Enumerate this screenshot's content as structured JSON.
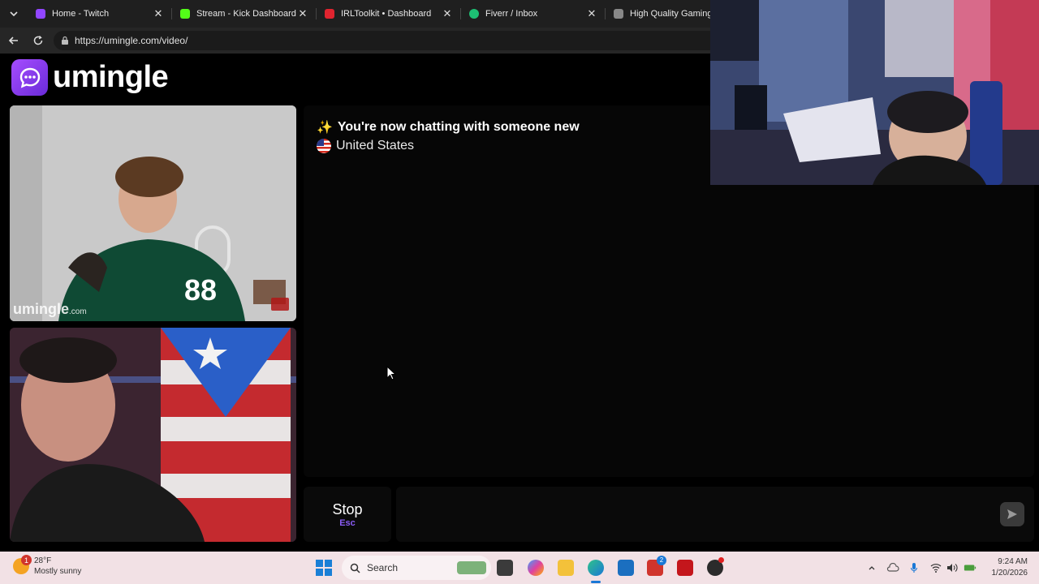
{
  "browser": {
    "tabs": [
      {
        "title": "Home - Twitch",
        "favicon_color": "#9146ff"
      },
      {
        "title": "Stream - Kick Dashboard",
        "favicon_color": "#53fc18"
      },
      {
        "title": "IRLToolkit • Dashboard",
        "favicon_color": "#e0242f"
      },
      {
        "title": "Fiverr / Inbox",
        "favicon_color": "#1dbf73"
      },
      {
        "title": "High Quality Gaming Ge",
        "favicon_color": "#888888"
      }
    ],
    "url": "https://umingle.com/video/"
  },
  "site": {
    "logo_text": "umingle",
    "brand_color": "#8b3dff"
  },
  "videos": {
    "stranger_watermark": "umingle",
    "stranger_watermark_suffix": ".com"
  },
  "chat": {
    "status_message": "You're now chatting with someone new",
    "country": "United States"
  },
  "controls": {
    "stop_label": "Stop",
    "stop_shortcut": "Esc",
    "message_value": ""
  },
  "taskbar": {
    "weather_temp": "28°F",
    "weather_desc": "Mostly sunny",
    "weather_badge": "1",
    "search_label": "Search",
    "notification_count": "2",
    "time": "9:24 AM",
    "date": "1/20/2026"
  }
}
